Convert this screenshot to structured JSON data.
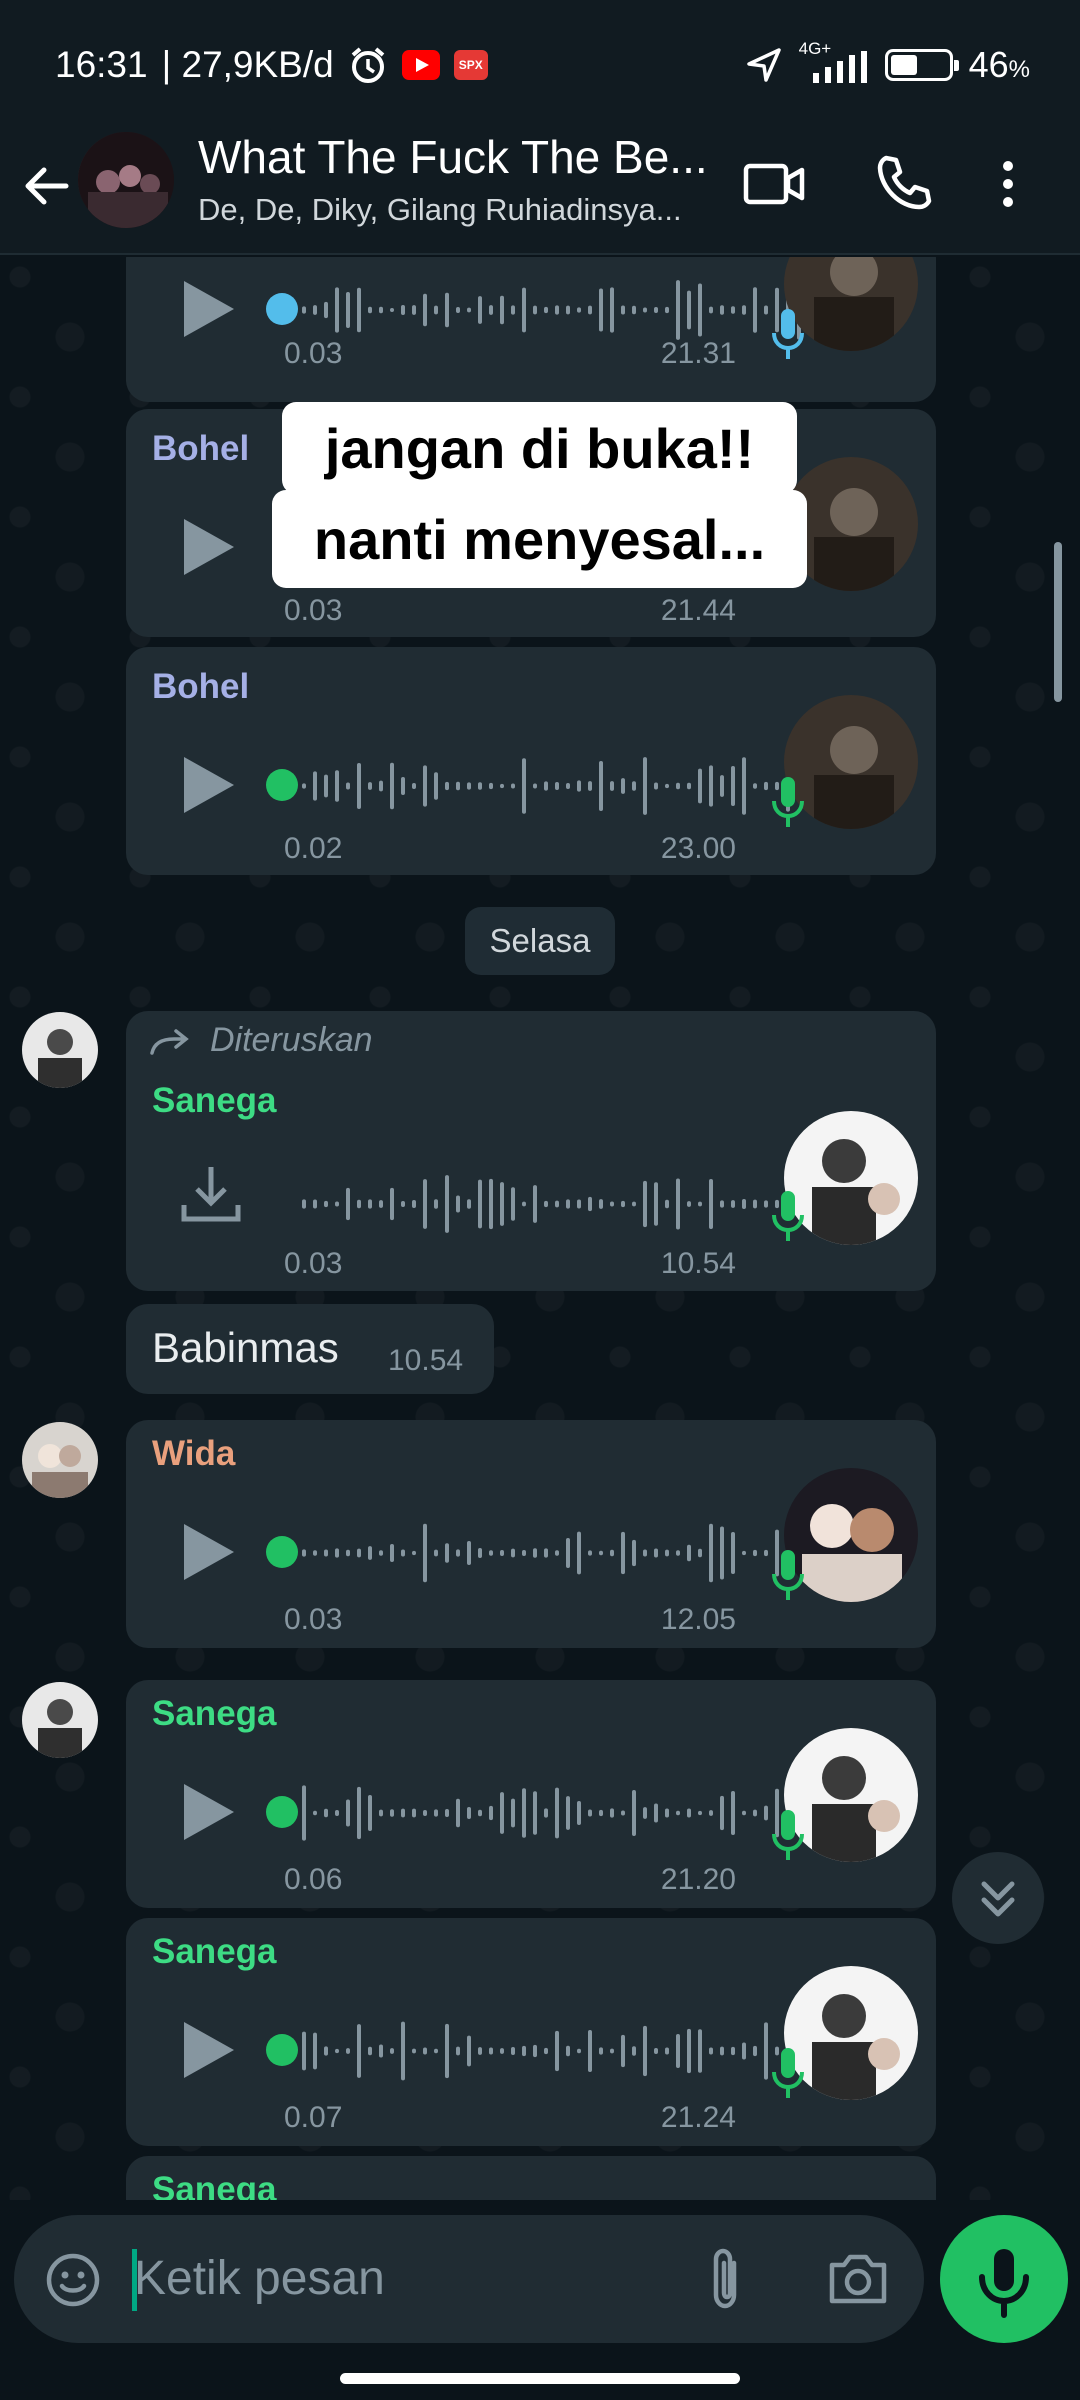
{
  "status_bar": {
    "time": "16:31",
    "net_speed": "| 27,9KB/d",
    "signal": "4G+",
    "battery": "46",
    "battery_unit": "%",
    "battery_level": 0.46,
    "badge_label": "SPX"
  },
  "header": {
    "title": "What The Fuck The Be...",
    "subtitle": "De, De, Diky, Gilang Ruhiadinsya..."
  },
  "overlay": {
    "line1": "jangan di buka!!",
    "line2": "nanti menyesal..."
  },
  "messages": [
    {
      "sender": "",
      "elapsed": "0.03",
      "time": "21.31",
      "dot_color": "#53bdeb"
    },
    {
      "sender": "Bohel",
      "elapsed": "0.03",
      "time": "21.44",
      "dot_color": "#53bdeb",
      "sender_color": "#a5b0e6"
    },
    {
      "sender": "Bohel",
      "elapsed": "0.02",
      "time": "23.00",
      "dot_color": "#21c063",
      "sender_color": "#a5b0e6"
    },
    {
      "sender": "Sanega",
      "forwarded": "Diteruskan",
      "elapsed": "0.03",
      "time": "10.54",
      "sender_color": "#3ddc84"
    },
    {
      "text": "Babinmas",
      "time": "10.54"
    },
    {
      "sender": "Wida",
      "elapsed": "0.03",
      "time": "12.05",
      "dot_color": "#21c063",
      "sender_color": "#e9a07d"
    },
    {
      "sender": "Sanega",
      "elapsed": "0.06",
      "time": "21.20",
      "dot_color": "#21c063",
      "sender_color": "#3ddc84"
    },
    {
      "sender": "Sanega",
      "elapsed": "0.07",
      "time": "21.24",
      "dot_color": "#21c063",
      "sender_color": "#3ddc84"
    },
    {
      "sender": "Sanega",
      "sender_color": "#3ddc84"
    }
  ],
  "day_separator": "Selasa",
  "input": {
    "placeholder": "Ketik pesan"
  },
  "colors": {
    "accent": "#21c063",
    "bubble": "#202c33",
    "background": "#0b141a"
  }
}
